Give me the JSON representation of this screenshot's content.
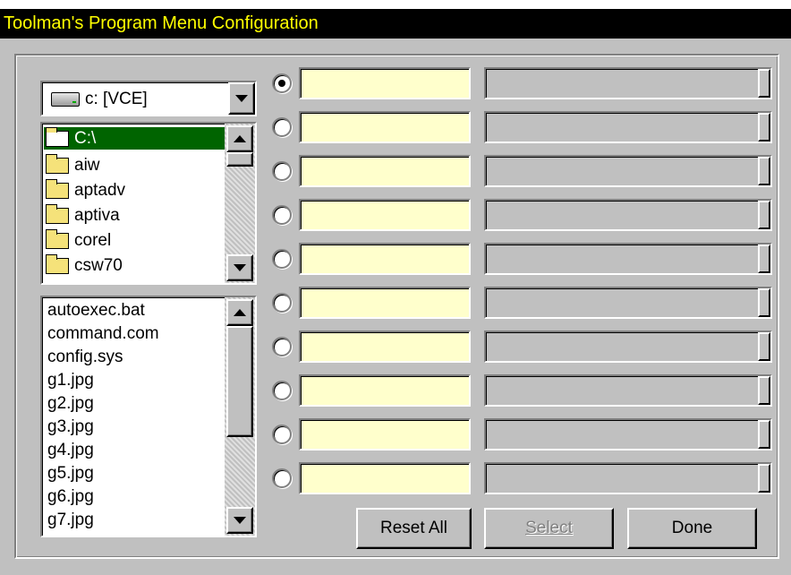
{
  "window": {
    "title": "Toolman's Program Menu Configuration"
  },
  "drive": {
    "selected": "c: [VCE]"
  },
  "directories": {
    "current": "C:\\",
    "items": [
      "aiw",
      "aptadv",
      "aptiva",
      "corel",
      "csw70"
    ]
  },
  "files": {
    "items": [
      "autoexec.bat",
      "command.com",
      "config.sys",
      "g1.jpg",
      "g2.jpg",
      "g3.jpg",
      "g4.jpg",
      "g5.jpg",
      "g6.jpg",
      "g7.jpg"
    ]
  },
  "menu_slots": {
    "count": 10,
    "selected_index": 0
  },
  "buttons": {
    "reset_all": "Reset All",
    "select": "Select",
    "done": "Done"
  },
  "colors": {
    "title_bg": "#000000",
    "title_fg": "#ffff00",
    "selection": "#006400",
    "name_field": "#ffffcc"
  }
}
